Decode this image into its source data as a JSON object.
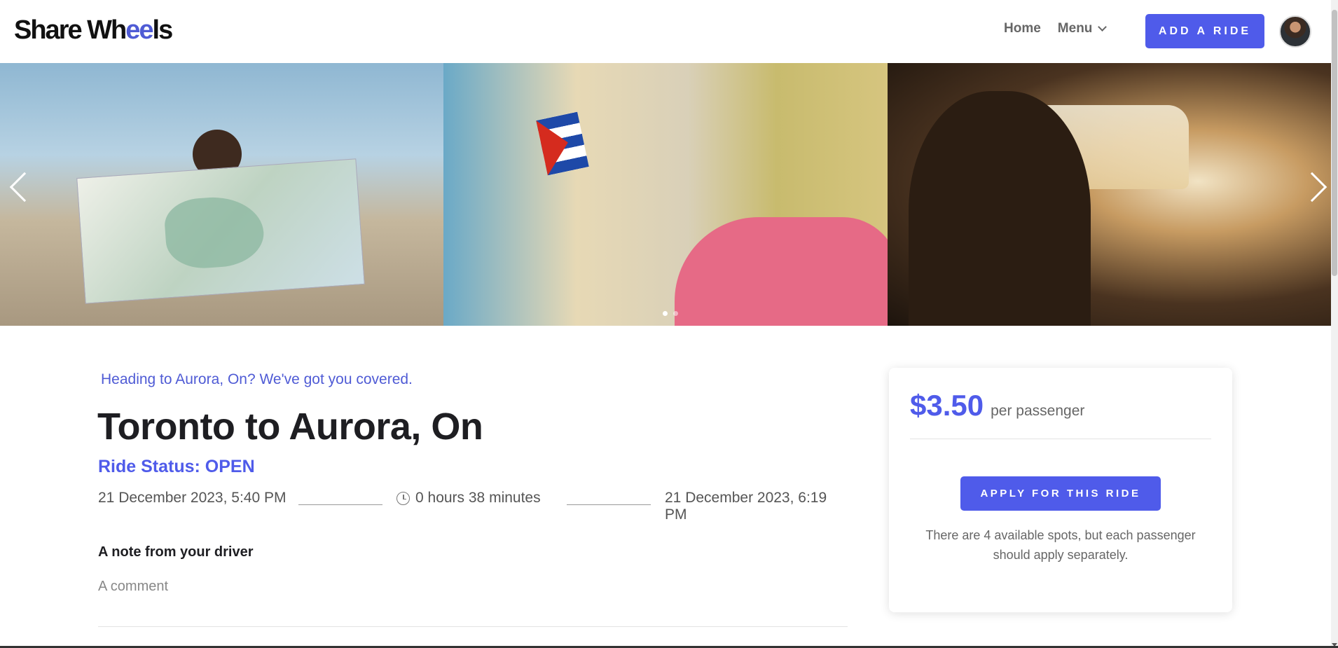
{
  "header": {
    "logo_text": "Share Wh",
    "logo_accent": "ee",
    "logo_tail": "ls",
    "nav": {
      "home": "Home",
      "menu": "Menu"
    },
    "add_ride_label": "ADD A RIDE"
  },
  "carousel": {
    "slides": 3,
    "active_dot": 0
  },
  "ride": {
    "tagline": "Heading to Aurora, On? We've got you covered.",
    "title": "Toronto to Aurora, On",
    "status": "Ride Status: OPEN",
    "departure": "21 December 2023, 5:40 PM",
    "duration": "0 hours 38 minutes",
    "arrival": "21 December 2023, 6:19 PM",
    "note_heading": "A note from your driver",
    "note_body": "A comment"
  },
  "pricing": {
    "price": "$3.50",
    "per": "per passenger",
    "apply_label": "APPLY FOR THIS RIDE",
    "spots_text": "There are 4 available spots, but each passenger should apply separately."
  },
  "colors": {
    "accent": "#4f5bea",
    "text_dark": "#1e1e22",
    "text_muted": "#666666"
  },
  "icons": [
    "chevron-down-icon",
    "clock-icon",
    "arrow-left-icon",
    "arrow-right-icon"
  ]
}
